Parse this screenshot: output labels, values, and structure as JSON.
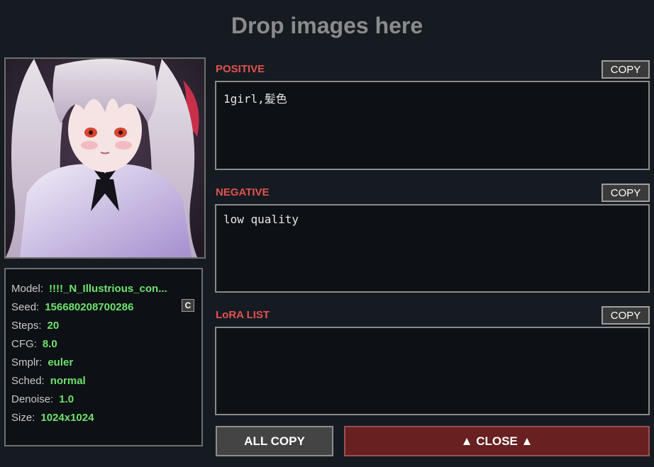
{
  "header": {
    "title": "Drop images here"
  },
  "preview": {
    "alt": "illustration of girl with long silver hair and red eyes"
  },
  "info": {
    "rows": [
      {
        "key": "Model:",
        "value": "!!!!_N_Illustrious_con..."
      },
      {
        "key": "Seed:",
        "value": "156680208700286"
      },
      {
        "key": "Steps:",
        "value": "20"
      },
      {
        "key": "CFG:",
        "value": "8.0"
      },
      {
        "key": "Smplr:",
        "value": "euler"
      },
      {
        "key": "Sched:",
        "value": "normal"
      },
      {
        "key": "Denoise:",
        "value": "1.0"
      },
      {
        "key": "Size:",
        "value": "1024x1024"
      }
    ],
    "seed_copy_label": "C"
  },
  "sections": {
    "positive": {
      "label": "POSITIVE",
      "copy_label": "COPY",
      "text": "1girl,髪色"
    },
    "negative": {
      "label": "NEGATIVE",
      "copy_label": "COPY",
      "text": "low quality"
    },
    "lora": {
      "label": "LoRA LIST",
      "copy_label": "COPY",
      "text": ""
    }
  },
  "footer": {
    "all_copy_label": "ALL COPY",
    "close_label": "▲ CLOSE ▲"
  },
  "colors": {
    "background": "#161b22",
    "section_label": "#e0534f",
    "value_green": "#6ee36e",
    "close_button": "#682021"
  }
}
